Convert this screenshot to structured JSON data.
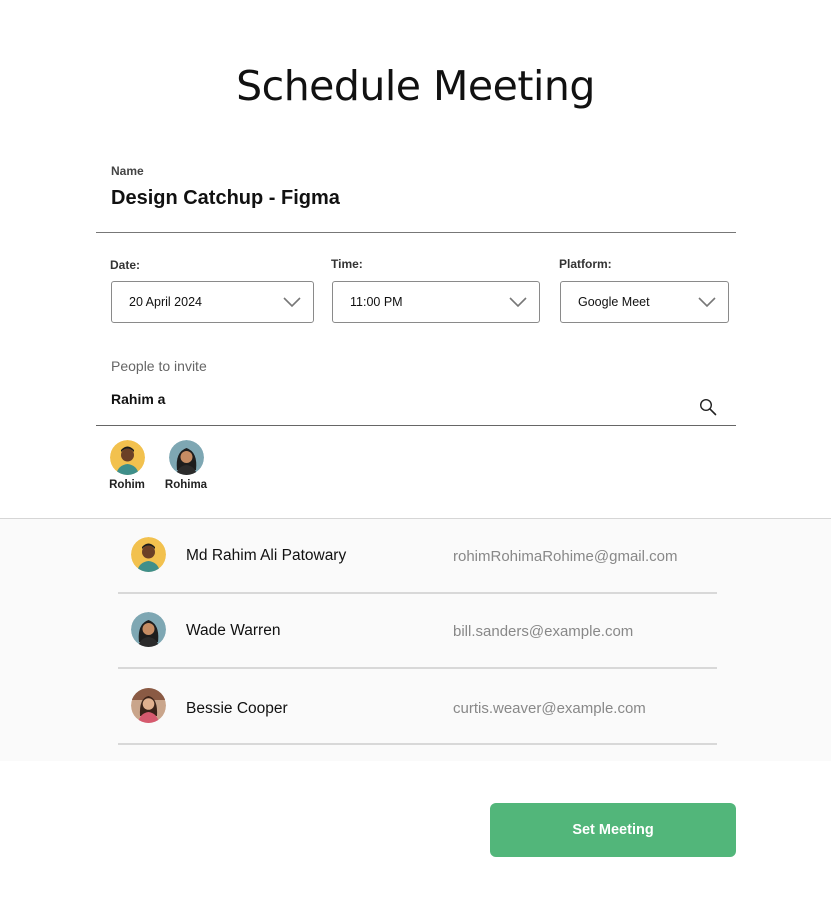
{
  "page": {
    "title": "Schedule Meeting"
  },
  "name_field": {
    "label": "Name",
    "value": "Design Catchup - Figma"
  },
  "date": {
    "label": "Date:",
    "value": "20 April  2024"
  },
  "time": {
    "label": "Time:",
    "value": "11:00 PM"
  },
  "platform": {
    "label": "Platform:",
    "value": "Google Meet"
  },
  "invite": {
    "label": "People to invite",
    "query": "Rahim a",
    "selected": [
      {
        "name": "Rohim"
      },
      {
        "name": "Rohima"
      }
    ]
  },
  "results": [
    {
      "name": "Md Rahim Ali Patowary",
      "email": "rohimRohimaRohime@gmail.com"
    },
    {
      "name": "Wade Warren",
      "email": "bill.sanders@example.com"
    },
    {
      "name": "Bessie Cooper",
      "email": "curtis.weaver@example.com"
    }
  ],
  "actions": {
    "set_meeting": "Set Meeting"
  },
  "colors": {
    "accent": "#52b67a",
    "avatar_yellow": "#f2c14e",
    "avatar_teal": "#7ea7b3"
  }
}
